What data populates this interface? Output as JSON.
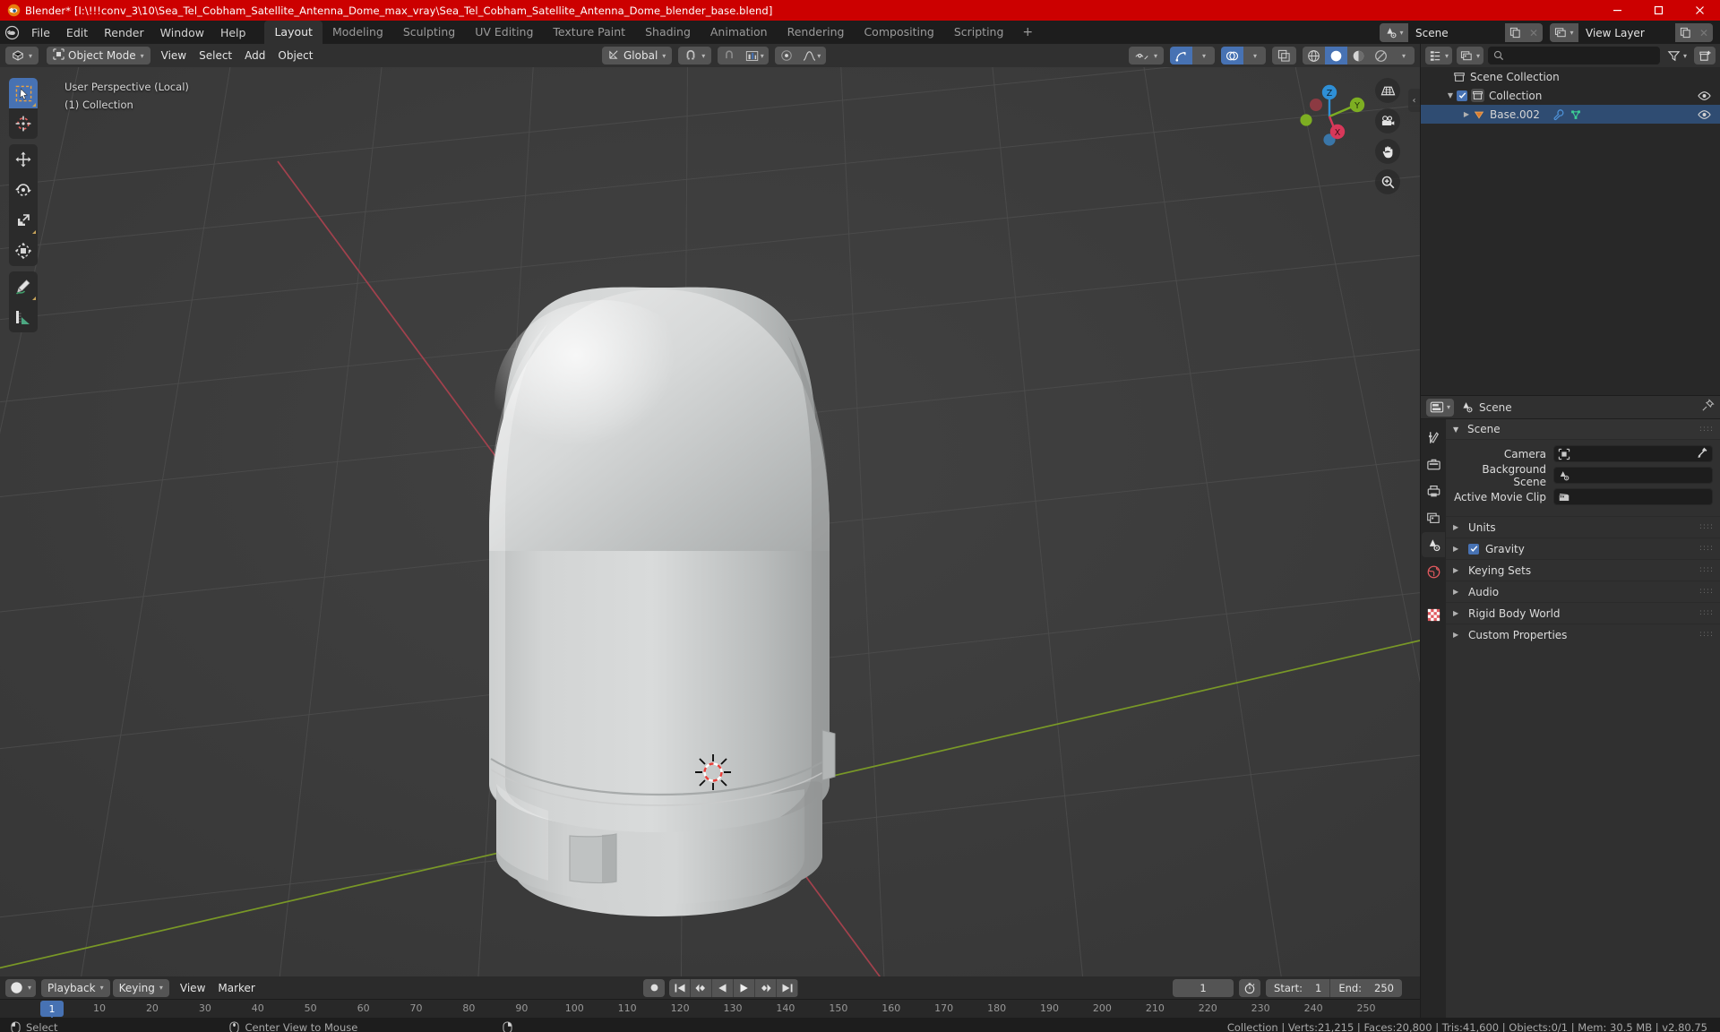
{
  "window": {
    "title": "Blender* [I:\\!!!conv_3\\10\\Sea_Tel_Cobham_Satellite_Antenna_Dome_max_vray\\Sea_Tel_Cobham_Satellite_Antenna_Dome_blender_base.blend]",
    "app_icon": "blender-logo-icon",
    "minimize": "–",
    "maximize": "❐",
    "close": "✕",
    "titlebar_color": "#cc0000"
  },
  "topbar": {
    "menus": [
      "File",
      "Edit",
      "Render",
      "Window",
      "Help"
    ],
    "workspaces": [
      {
        "label": "Layout",
        "active": true
      },
      {
        "label": "Modeling",
        "active": false
      },
      {
        "label": "Sculpting",
        "active": false
      },
      {
        "label": "UV Editing",
        "active": false
      },
      {
        "label": "Texture Paint",
        "active": false
      },
      {
        "label": "Shading",
        "active": false
      },
      {
        "label": "Animation",
        "active": false
      },
      {
        "label": "Rendering",
        "active": false
      },
      {
        "label": "Compositing",
        "active": false
      },
      {
        "label": "Scripting",
        "active": false
      }
    ],
    "add_workspace": "+",
    "scene_selector": {
      "value": "Scene",
      "icon": "scene-icon",
      "copy": "copy-icon",
      "unlink": "✕"
    },
    "viewlayer_selector": {
      "value": "View Layer",
      "icon": "view-layer-icon",
      "copy": "copy-icon",
      "unlink": "✕"
    }
  },
  "viewport": {
    "header": {
      "editor_type_icon": "editor-type-3dview-icon",
      "mode": "Object Mode",
      "mode_icon": "object-mode-icon",
      "menus": [
        "View",
        "Select",
        "Add",
        "Object"
      ],
      "transform_orientation": {
        "label": "Global",
        "icon": "orientation-icon"
      },
      "snap_magnet_icon": "snap-magnet-icon",
      "snap_target_icon": "snap-increment-icon",
      "proportional_edit_icon": "proportional-edit-icon",
      "falloff_icon": "smooth-falloff-icon",
      "right_icons": [
        "visibility-icon",
        "gizmo-icon",
        "overlays-icon",
        "xray-icon",
        "shading-wireframe-icon",
        "shading-solid-icon",
        "shading-material-icon",
        "shading-rendered-icon"
      ]
    },
    "overlay_line1": "User Perspective (Local)",
    "overlay_line2": "(1) Collection",
    "toolbar": [
      {
        "name": "tweak-select-box-tool",
        "icon": "cursor-box-select-icon",
        "active": true
      },
      {
        "name": "cursor-tool",
        "icon": "3d-cursor-icon",
        "active": false
      },
      {
        "name": "move-tool",
        "icon": "move-arrows-icon",
        "active": false
      },
      {
        "name": "rotate-tool",
        "icon": "rotate-icon",
        "active": false
      },
      {
        "name": "scale-tool",
        "icon": "scale-icon",
        "active": false
      },
      {
        "name": "transform-tool",
        "icon": "transform-icon",
        "active": false
      },
      {
        "name": "annotate-tool",
        "icon": "pencil-annotate-icon",
        "active": false
      },
      {
        "name": "measure-tool",
        "icon": "ruler-measure-icon",
        "active": false
      }
    ],
    "nav_icons": [
      "grid-ortho-icon",
      "camera-view-icon",
      "hand-pan-icon",
      "zoom-magnifier-icon"
    ],
    "gizmo_axes": [
      {
        "label": "Z",
        "color": "#2e8fd6"
      },
      {
        "label": "Y",
        "color": "#7dae22"
      },
      {
        "label": "X",
        "color": "#d8385a"
      }
    ],
    "sidepanel_toggle": "‹",
    "grid_color": "#4a4a4a",
    "background_color": "#3b3b3b",
    "axis_x_color": "#b44450",
    "axis_y_color": "#7a9e22",
    "object_color": "#c4c6c6",
    "cursor_3d": "3d-cursor-crosshair"
  },
  "timeline": {
    "editor_icon": "timeline-editor-icon",
    "menus": [
      {
        "label": "Playback",
        "dropdown": true
      },
      {
        "label": "Keying",
        "dropdown": true
      },
      {
        "label": "View",
        "dropdown": false
      },
      {
        "label": "Marker",
        "dropdown": false
      }
    ],
    "record_icon": "record-icon",
    "playback_buttons": [
      "jump-to-start-icon",
      "jump-prev-keyframe-icon",
      "play-reverse-icon",
      "play-icon",
      "jump-next-keyframe-icon",
      "jump-to-end-icon"
    ],
    "current_frame": "1",
    "use_preview_range_icon": "stopwatch-icon",
    "start_label": "Start:",
    "start_value": "1",
    "end_label": "End:",
    "end_value": "250",
    "ticks": [
      "10",
      "20",
      "30",
      "40",
      "50",
      "60",
      "70",
      "80",
      "90",
      "100",
      "110",
      "120",
      "130",
      "140",
      "150",
      "160",
      "170",
      "180",
      "190",
      "200",
      "210",
      "220",
      "230",
      "240",
      "250"
    ],
    "playhead_label": "1"
  },
  "outliner": {
    "display_mode_icon": "outliner-view-layer-icon",
    "filter_id_icon": "filter-id-icon",
    "search_placeholder": "",
    "search_icon": "search-icon",
    "filter_icon": "funnel-filter-icon",
    "new_collection_icon": "new-collection-icon",
    "rows": [
      {
        "label": "Scene Collection",
        "icon": "collection-icon",
        "indent": 0,
        "has_triangle": false,
        "has_checkbox": false,
        "has_eye": false,
        "selected": false
      },
      {
        "label": "Collection",
        "icon": "collection-icon",
        "indent": 1,
        "has_triangle": true,
        "triangle": "▼",
        "has_checkbox": true,
        "has_eye": true,
        "selected": false
      },
      {
        "label": "Base.002",
        "icon": "mesh-triangle-icon",
        "indent": 2,
        "has_triangle": true,
        "triangle": "▶",
        "has_checkbox": false,
        "has_eye": true,
        "selected": true,
        "extra_icons": [
          "modifier-wrench-icon",
          "mesh-data-icon"
        ]
      }
    ]
  },
  "properties": {
    "editor_icon": "properties-editor-icon",
    "breadcrumb_icon": "scene-props-icon",
    "breadcrumb": "Scene",
    "pin_icon": "pin-icon",
    "tabs": [
      {
        "name": "tool-tab",
        "icon": "tool-screwdriver-icon",
        "active": false
      },
      {
        "name": "render-tab",
        "icon": "render-camera-back-icon",
        "active": false
      },
      {
        "name": "output-tab",
        "icon": "output-printer-icon",
        "active": false
      },
      {
        "name": "view-layer-tab",
        "icon": "view-layer-images-icon",
        "active": false
      },
      {
        "name": "scene-tab",
        "icon": "scene-cone-icon",
        "active": true
      },
      {
        "name": "world-tab",
        "icon": "world-globe-icon",
        "active": false
      },
      {
        "name": "texture-tab",
        "icon": "texture-checker-icon",
        "active": false
      }
    ],
    "panel_title": "Scene",
    "panel_expanded": true,
    "fields": [
      {
        "label": "Camera",
        "icon": "camera-object-icon",
        "value": "",
        "eyedropper": true
      },
      {
        "label": "Background Scene",
        "icon": "scene-icon",
        "value": "",
        "eyedropper": false
      },
      {
        "label": "Active Movie Clip",
        "icon": "movie-clip-icon",
        "value": "",
        "eyedropper": false
      }
    ],
    "subpanels": [
      {
        "label": "Units",
        "checkbox": false,
        "expanded": false
      },
      {
        "label": "Gravity",
        "checkbox": true,
        "checked": true,
        "expanded": false
      },
      {
        "label": "Keying Sets",
        "checkbox": false,
        "expanded": false
      },
      {
        "label": "Audio",
        "checkbox": false,
        "expanded": false
      },
      {
        "label": "Rigid Body World",
        "checkbox": false,
        "expanded": false
      },
      {
        "label": "Custom Properties",
        "checkbox": false,
        "expanded": false
      }
    ]
  },
  "statusbar": {
    "mouse_left": {
      "icon": "mouse-left-icon",
      "label": "Select"
    },
    "mouse_middle": {
      "icon": "mouse-middle-icon",
      "label": "Center View to Mouse"
    },
    "mouse_right": {
      "icon": "mouse-right-icon",
      "label": ""
    },
    "stats": "Collection | Verts:21,215 | Faces:20,800 | Tris:41,600 | Objects:0/1 | Mem: 30.5 MB | v2.80.75"
  }
}
